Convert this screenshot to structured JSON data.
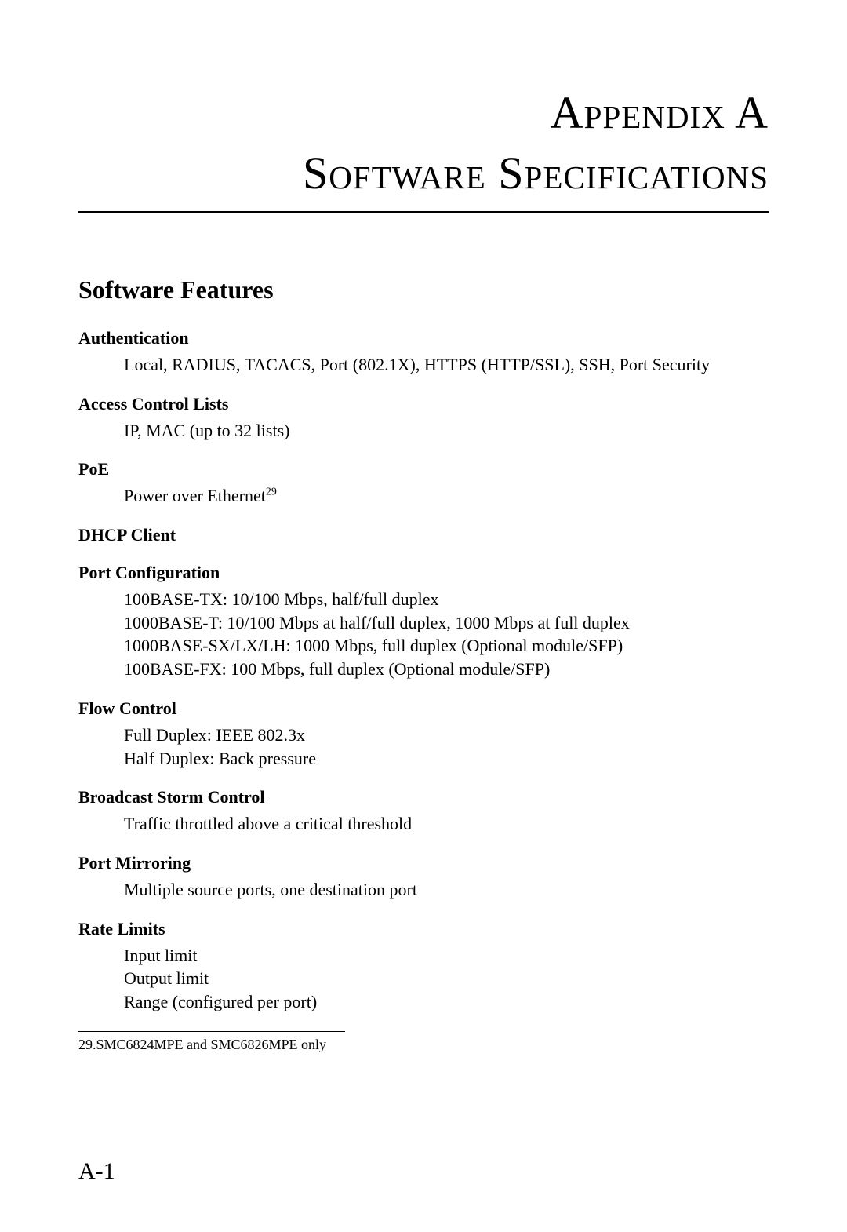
{
  "appendix": "Appendix A",
  "chapter": "Software Specifications",
  "section": "Software Features",
  "features": {
    "authentication": {
      "heading": "Authentication",
      "body": "Local, RADIUS, TACACS, Port (802.1X), HTTPS (HTTP/SSL), SSH, Port Security"
    },
    "acl": {
      "heading": "Access Control Lists",
      "body": "IP, MAC (up to 32 lists)"
    },
    "poe": {
      "heading": "PoE",
      "body_prefix": "Power over Ethernet",
      "footnote_ref": "29"
    },
    "dhcp": {
      "heading": "DHCP Client"
    },
    "portconfig": {
      "heading": "Port Configuration",
      "line1": "100BASE-TX: 10/100 Mbps, half/full duplex",
      "line2": "1000BASE-T: 10/100 Mbps at half/full duplex, 1000 Mbps at full duplex",
      "line3": "1000BASE-SX/LX/LH: 1000 Mbps, full duplex (Optional module/SFP)",
      "line4": "100BASE-FX: 100 Mbps, full duplex (Optional module/SFP)"
    },
    "flowcontrol": {
      "heading": "Flow Control",
      "line1": "Full Duplex: IEEE 802.3x",
      "line2": "Half Duplex: Back pressure"
    },
    "broadcast": {
      "heading": "Broadcast Storm Control",
      "body": "Traffic throttled above a critical threshold"
    },
    "mirroring": {
      "heading": "Port Mirroring",
      "body": "Multiple source ports, one destination port"
    },
    "ratelimits": {
      "heading": "Rate Limits",
      "line1": "Input limit",
      "line2": "Output limit",
      "line3": "Range (configured per port)"
    }
  },
  "footnote": {
    "number": "29.",
    "text": "SMC6824MPE and SMC6826MPE only"
  },
  "page_number": "A-1"
}
